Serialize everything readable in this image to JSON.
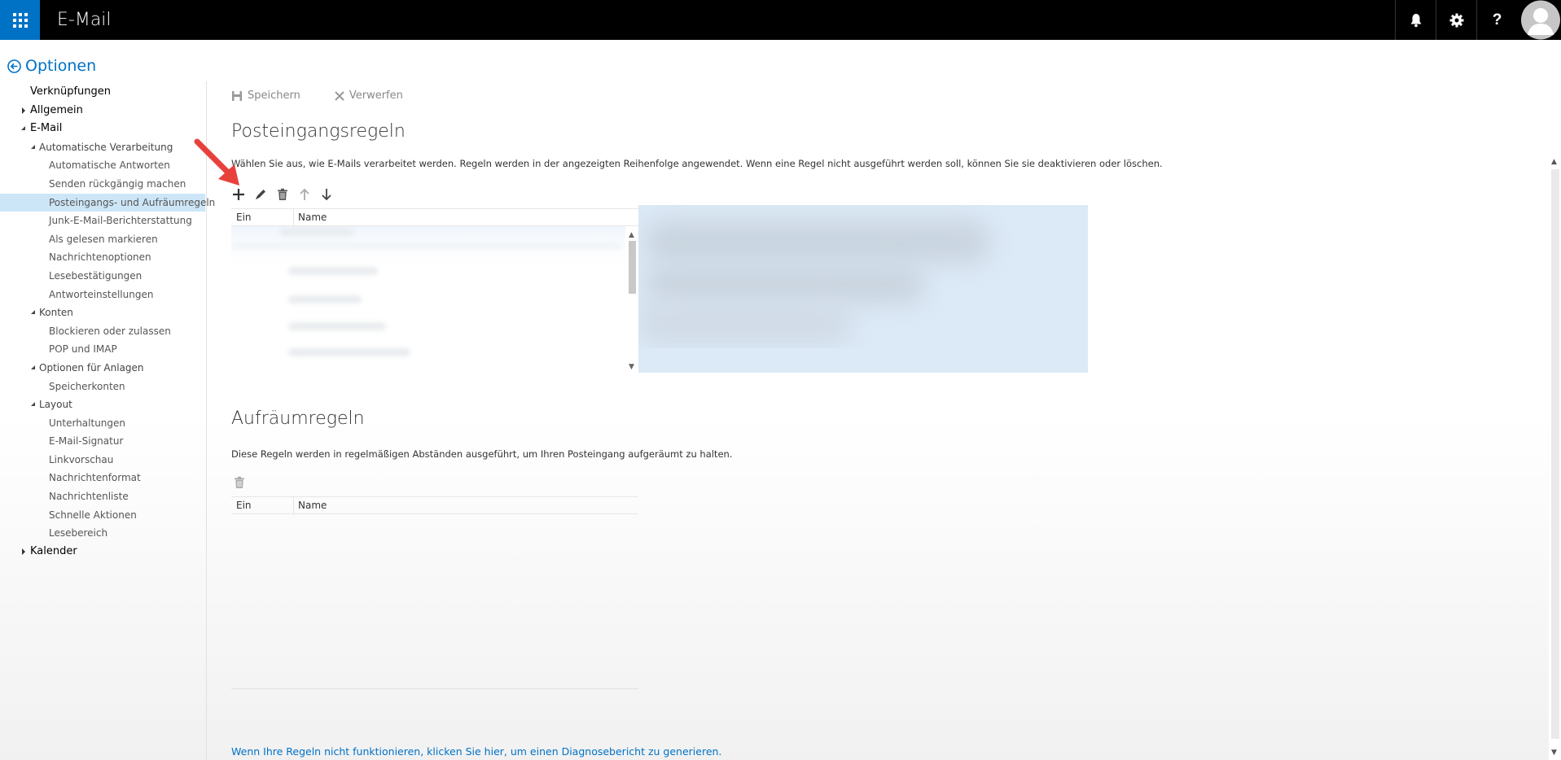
{
  "app": {
    "title": "E-Mail"
  },
  "header_icons": [
    "waffle-icon",
    "bell-icon",
    "gear-icon",
    "help-icon",
    "avatar"
  ],
  "back_link": {
    "label": "Optionen"
  },
  "nav": {
    "items": [
      {
        "label": "Verknüpfungen",
        "level": 0,
        "arrow": "none"
      },
      {
        "label": "Allgemein",
        "level": 0,
        "arrow": "right"
      },
      {
        "label": "E-Mail",
        "level": 0,
        "arrow": "down"
      },
      {
        "label": "Automatische Verarbeitung",
        "level": 1,
        "arrow": "down"
      },
      {
        "label": "Automatische Antworten",
        "level": 2,
        "arrow": "none"
      },
      {
        "label": "Senden rückgängig machen",
        "level": 2,
        "arrow": "none"
      },
      {
        "label": "Posteingangs- und Aufräumregeln",
        "level": 2,
        "arrow": "none",
        "selected": true
      },
      {
        "label": "Junk-E-Mail-Berichterstattung",
        "level": 2,
        "arrow": "none"
      },
      {
        "label": "Als gelesen markieren",
        "level": 2,
        "arrow": "none"
      },
      {
        "label": "Nachrichtenoptionen",
        "level": 2,
        "arrow": "none"
      },
      {
        "label": "Lesebestätigungen",
        "level": 2,
        "arrow": "none"
      },
      {
        "label": "Antworteinstellungen",
        "level": 2,
        "arrow": "none"
      },
      {
        "label": "Konten",
        "level": 1,
        "arrow": "down"
      },
      {
        "label": "Blockieren oder zulassen",
        "level": 2,
        "arrow": "none"
      },
      {
        "label": "POP und IMAP",
        "level": 2,
        "arrow": "none"
      },
      {
        "label": "Optionen für Anlagen",
        "level": 1,
        "arrow": "down"
      },
      {
        "label": "Speicherkonten",
        "level": 2,
        "arrow": "none"
      },
      {
        "label": "Layout",
        "level": 1,
        "arrow": "down"
      },
      {
        "label": "Unterhaltungen",
        "level": 2,
        "arrow": "none"
      },
      {
        "label": "E-Mail-Signatur",
        "level": 2,
        "arrow": "none"
      },
      {
        "label": "Linkvorschau",
        "level": 2,
        "arrow": "none"
      },
      {
        "label": "Nachrichtenformat",
        "level": 2,
        "arrow": "none"
      },
      {
        "label": "Nachrichtenliste",
        "level": 2,
        "arrow": "none"
      },
      {
        "label": "Schnelle Aktionen",
        "level": 2,
        "arrow": "none"
      },
      {
        "label": "Lesebereich",
        "level": 2,
        "arrow": "none"
      },
      {
        "label": "Kalender",
        "level": 0,
        "arrow": "right"
      }
    ]
  },
  "toolbar": {
    "save_label": "Speichern",
    "discard_label": "Verwerfen"
  },
  "inbox_rules": {
    "title": "Posteingangsregeln",
    "description": "Wählen Sie aus, wie E-Mails verarbeitet werden. Regeln werden in der angezeigten Reihenfolge angewendet. Wenn eine Regel nicht ausgeführt werden soll, können Sie sie deaktivieren oder löschen.",
    "columns": [
      "Ein",
      "Name"
    ]
  },
  "cleanup_rules": {
    "title": "Aufräumregeln",
    "description": "Diese Regeln werden in regelmäßigen Abständen ausgeführt, um Ihren Posteingang aufgeräumt zu halten.",
    "columns": [
      "Ein",
      "Name"
    ]
  },
  "diagnostic_link": "Wenn Ihre Regeln nicht funktionieren, klicken Sie hier, um einen Diagnosebericht zu generieren.",
  "colors": {
    "accent": "#0072c6",
    "selected_bg": "#cde6f7",
    "arrow_red": "#e8413c"
  }
}
